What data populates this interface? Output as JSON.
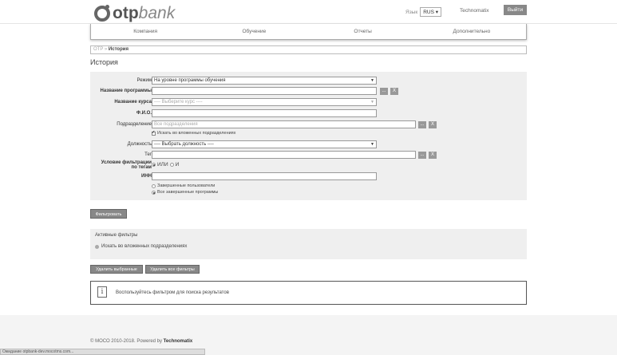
{
  "header": {
    "logo_otp": "otp",
    "logo_bank": "bank",
    "lang_label": "Язык",
    "lang_value": "RUS",
    "user": "Technomatix",
    "logout": "Выйти"
  },
  "nav": [
    "Компания",
    "Обучение",
    "Отчеты",
    "Дополнительно"
  ],
  "breadcrumb": {
    "root": "OTP",
    "sep": "»",
    "current": "История"
  },
  "page_title": "История",
  "filters": {
    "mode_label": "Режим",
    "mode_value": "На уровне программы обучения",
    "program_label": "Название программы",
    "course_label": "Название курса",
    "course_placeholder": "---- Выберите курс ----",
    "fio_label": "Ф.И.О.",
    "dept_label": "Подразделение",
    "dept_placeholder": "Все подразделения",
    "nested_label": "Искать во вложенных подразделениях",
    "position_label": "Должность",
    "position_value": "---- Выбрать должность ----",
    "tag_label": "Тег",
    "tag_cond_label1": "Условие фильтрации",
    "tag_cond_label2": "по тегам",
    "or_label": "ИЛИ",
    "and_label": "И",
    "inn_label": "ИНН",
    "completed_users": "Завершенные пользователи",
    "all_completed": "Все завершенные программы",
    "browse": "...",
    "clear": "X"
  },
  "filter_button": "Фильтровать",
  "active_filters": {
    "title": "Активные фильтры",
    "item": "Искать во вложенных подразделениях"
  },
  "delete_selected": "Удалить выбранные",
  "delete_all": "Удалить все фильтры",
  "info": {
    "icon": "i",
    "text": "Воспользуйтесь фильтром для поиска результатов"
  },
  "footer": {
    "copyright": "© МОСО 2010-2018. Powered by",
    "brand": "Technomatix"
  },
  "status_bar": "Ожидание otpbank-dev.mocotms.com..."
}
